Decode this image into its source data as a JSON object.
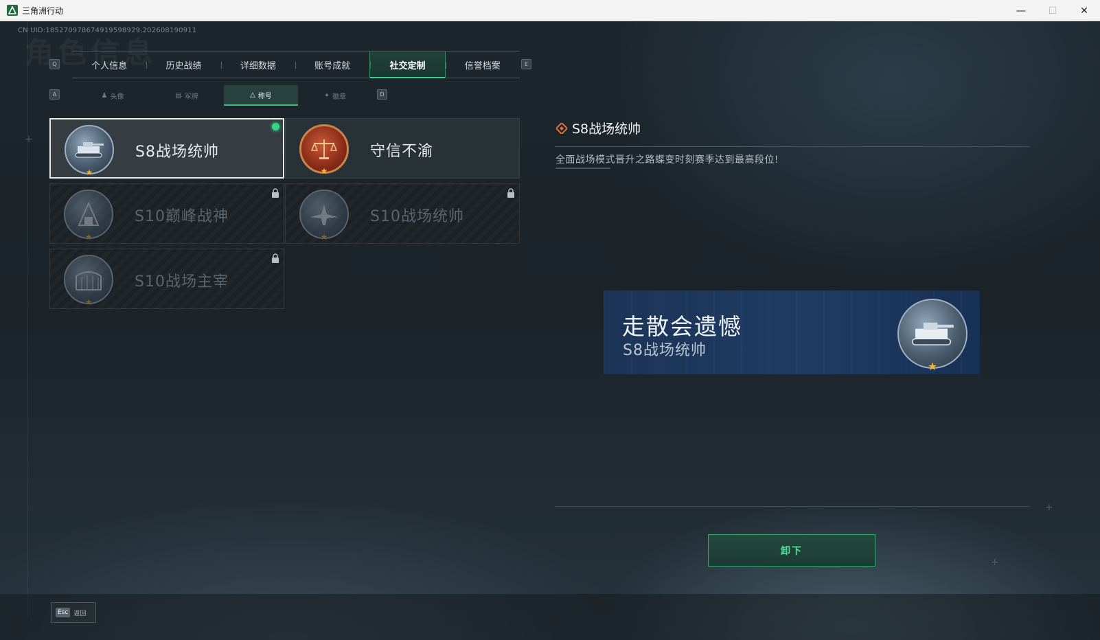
{
  "window": {
    "title": "三角洲行动",
    "controls": {
      "minimize": "—",
      "maximize": "☐",
      "close": "✕"
    }
  },
  "uid_text": "CN UID:185270978674919598929,202608190911",
  "ghost_title": "角色信息",
  "keys": {
    "prev_main": "Q",
    "next_main": "E",
    "prev_sub": "A",
    "next_sub": "D"
  },
  "main_tabs": [
    {
      "label": "个人信息",
      "active": false
    },
    {
      "label": "历史战绩",
      "active": false
    },
    {
      "label": "详细数据",
      "active": false
    },
    {
      "label": "账号成就",
      "active": false
    },
    {
      "label": "社交定制",
      "active": true
    },
    {
      "label": "信誉档案",
      "active": false
    }
  ],
  "sub_tabs": [
    {
      "label": "头像",
      "icon": "person-icon",
      "active": false
    },
    {
      "label": "军牌",
      "icon": "dogtag-icon",
      "active": false
    },
    {
      "label": "称号",
      "icon": "title-icon",
      "active": true
    },
    {
      "label": "徽章",
      "icon": "emblem-icon",
      "active": false
    }
  ],
  "titles": [
    {
      "name": "S8战场统帅",
      "icon": "tank-medal-icon",
      "selected": true,
      "equipped": true,
      "locked": false
    },
    {
      "name": "守信不渝",
      "icon": "scales-medal-icon",
      "selected": false,
      "equipped": false,
      "locked": false
    },
    {
      "name": "S10巅峰战神",
      "icon": "tower-medal-icon",
      "selected": false,
      "equipped": false,
      "locked": true
    },
    {
      "name": "S10战场统帅",
      "icon": "aircraft-medal-icon",
      "selected": false,
      "equipped": false,
      "locked": true
    },
    {
      "name": "S10战场主宰",
      "icon": "colosseum-medal-icon",
      "selected": false,
      "equipped": false,
      "locked": true
    }
  ],
  "detail": {
    "title": "S8战场统帅",
    "description": "全面战场模式晋升之路蝶变时刻赛季达到最高段位!",
    "preview": {
      "name": "走散会遗憾",
      "title": "S8战场统帅"
    },
    "unequip_label": "卸下"
  },
  "footer": {
    "esc_key": "Esc",
    "back_label": "返回"
  },
  "colors": {
    "accent": "#37d687",
    "preview_bg": "#1f3b63",
    "star": "#f2b334"
  }
}
